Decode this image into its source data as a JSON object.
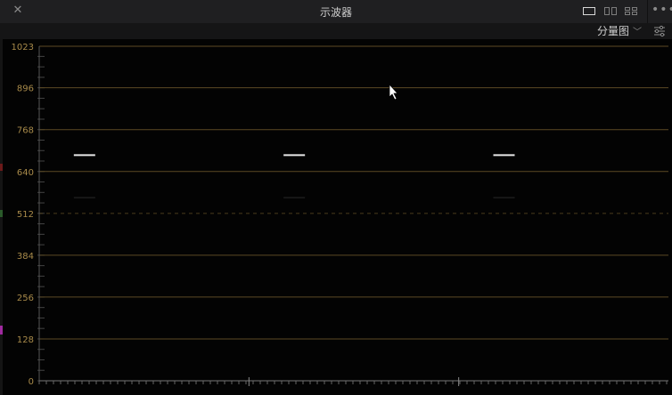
{
  "window": {
    "title": "示波器",
    "close_icon": "close-icon",
    "layout_icons": [
      "single-view-icon",
      "dual-view-icon",
      "quad-view-icon"
    ],
    "more_icon": "more-horizontal-icon"
  },
  "toolbar": {
    "view_mode": "分量图",
    "dropdown_icon": "chevron-down-icon",
    "settings_icon": "sliders-settings-icon"
  },
  "scope": {
    "axis_labels": [
      "1023",
      "896",
      "768",
      "640",
      "512",
      "384",
      "256",
      "128",
      "0"
    ],
    "axis_values": [
      1023,
      896,
      768,
      640,
      512,
      384,
      256,
      128,
      0
    ],
    "dashed_level": 512,
    "channels": 3,
    "trace_level": 690,
    "grid_color": "#5c4a24",
    "label_color": "#a88a4a",
    "trace_color": "#e8e8e8"
  }
}
